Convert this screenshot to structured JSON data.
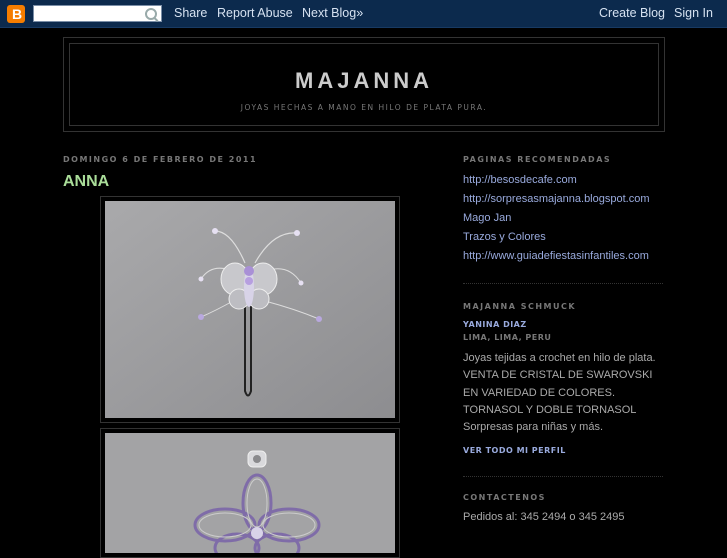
{
  "navbar": {
    "logo_letter": "B",
    "search_value": "",
    "share": "Share",
    "report_abuse": "Report Abuse",
    "next_blog": "Next Blog»",
    "create_blog": "Create Blog",
    "sign_in": "Sign In"
  },
  "header": {
    "title": "MAJANNA",
    "description": "JOYAS HECHAS A MANO EN HILO DE PLATA PURA."
  },
  "post": {
    "date": "DOMINGO 6 DE FEBRERO DE 2011",
    "title": "ANNA"
  },
  "sidebar": {
    "recommended_heading": "PAGINAS RECOMENDADAS",
    "links": [
      "http://besosdecafe.com",
      "http://sorpresasmajanna.blogspot.com",
      "Mago Jan",
      "Trazos y Colores",
      "http://www.guiadefiestasinfantiles.com"
    ],
    "profile_heading": "MAJANNA SCHMUCK",
    "profile_name": "YANINA DIAZ",
    "profile_location": "LIMA, LIMA, PERU",
    "profile_about": [
      "Joyas tejidas a crochet en hilo de plata.",
      "VENTA DE CRISTAL DE SWAROVSKI",
      "EN VARIEDAD DE COLORES.",
      "TORNASOL Y DOBLE TORNASOL",
      "Sorpresas para niñas y más."
    ],
    "view_profile": "VER TODO MI PERFIL",
    "contact_heading": "CONTACTENOS",
    "contact_text": "Pedidos al: 345 2494 o 345 2495"
  },
  "colors": {
    "background": "#000000",
    "navbar": "#0c2a4d",
    "post_title": "#aadd99",
    "link": "#99aadd"
  }
}
